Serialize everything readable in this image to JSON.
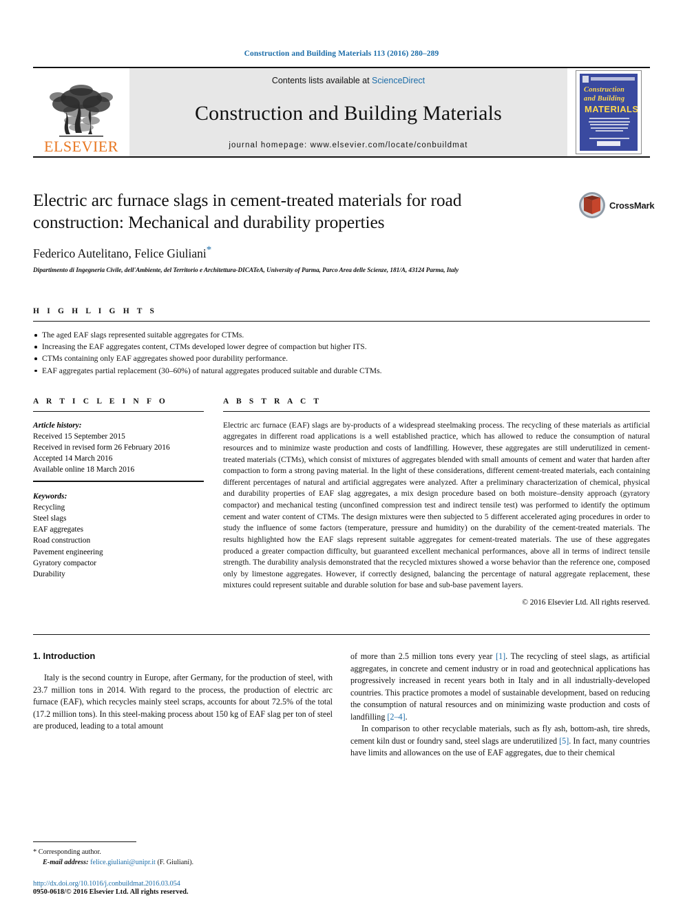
{
  "running_head": "Construction and Building Materials 113 (2016) 280–289",
  "masthead": {
    "publisher": "ELSEVIER",
    "contents_prefix": "Contents lists available at ",
    "contents_link": "ScienceDirect",
    "journal_name": "Construction and Building Materials",
    "homepage": "journal homepage: www.elsevier.com/locate/conbuildmat",
    "cover": {
      "line1": "Construction",
      "line2": "and Building",
      "line3": "MATERIALS"
    }
  },
  "article": {
    "title": "Electric arc furnace slags in cement-treated materials for road construction: Mechanical and durability properties",
    "authors": "Federico Autelitano, Felice Giuliani",
    "corresponding_marker": "*",
    "affiliation": "Dipartimento di Ingegneria Civile, dell'Ambiente, del Territorio e Architettura-DICATeA, University of Parma, Parco Area delle Scienze, 181/A, 43124 Parma, Italy",
    "crossmark_label": "CrossMark"
  },
  "highlights": {
    "heading": "H I G H L I G H T S",
    "items": [
      "The aged EAF slags represented suitable aggregates for CTMs.",
      "Increasing the EAF aggregates content, CTMs developed lower degree of compaction but higher ITS.",
      "CTMs containing only EAF aggregates showed poor durability performance.",
      "EAF aggregates partial replacement (30–60%) of natural aggregates produced suitable and durable CTMs."
    ]
  },
  "article_info": {
    "heading": "A R T I C L E    I N F O",
    "history_label": "Article history:",
    "history": [
      "Received 15 September 2015",
      "Received in revised form 26 February 2016",
      "Accepted 14 March 2016",
      "Available online 18 March 2016"
    ],
    "keywords_label": "Keywords:",
    "keywords": [
      "Recycling",
      "Steel slags",
      "EAF aggregates",
      "Road construction",
      "Pavement engineering",
      "Gyratory compactor",
      "Durability"
    ]
  },
  "abstract": {
    "heading": "A B S T R A C T",
    "text": "Electric arc furnace (EAF) slags are by-products of a widespread steelmaking process. The recycling of these materials as artificial aggregates in different road applications is a well established practice, which has allowed to reduce the consumption of natural resources and to minimize waste production and costs of landfilling. However, these aggregates are still underutilized in cement-treated materials (CTMs), which consist of mixtures of aggregates blended with small amounts of cement and water that harden after compaction to form a strong paving material. In the light of these considerations, different cement-treated materials, each containing different percentages of natural and artificial aggregates were analyzed. After a preliminary characterization of chemical, physical and durability properties of EAF slag aggregates, a mix design procedure based on both moisture–density approach (gyratory compactor) and mechanical testing (unconfined compression test and indirect tensile test) was performed to identify the optimum cement and water content of CTMs. The design mixtures were then subjected to 5 different accelerated aging procedures in order to study the influence of some factors (temperature, pressure and humidity) on the durability of the cement-treated materials. The results highlighted how the EAF slags represent suitable aggregates for cement-treated materials. The use of these aggregates produced a greater compaction difficulty, but guaranteed excellent mechanical performances, above all in terms of indirect tensile strength. The durability analysis demonstrated that the recycled mixtures showed a worse behavior than the reference one, composed only by limestone aggregates. However, if correctly designed, balancing the percentage of natural aggregate replacement, these mixtures could represent suitable and durable solution for base and sub-base pavement layers.",
    "copyright": "© 2016 Elsevier Ltd. All rights reserved."
  },
  "introduction": {
    "section_title": "1. Introduction",
    "left_paragraph": "Italy is the second country in Europe, after Germany, for the production of steel, with 23.7 million tons in 2014. With regard to the process, the production of electric arc furnace (EAF), which recycles mainly steel scraps, accounts for about 72.5% of the total (17.2 million tons). In this steel-making process about 150 kg of EAF slag per ton of steel are produced, leading to a total amount",
    "right_paragraph_1_a": "of more than 2.5 million tons every year ",
    "right_paragraph_1_ref1": "[1]",
    "right_paragraph_1_b": ". The recycling of steel slags, as artificial aggregates, in concrete and cement industry or in road and geotechnical applications has progressively increased in recent years both in Italy and in all industrially-developed countries. This practice promotes a model of sustainable development, based on reducing the consumption of natural resources and on minimizing waste production and costs of landfilling ",
    "right_paragraph_1_ref2": "[2–4]",
    "right_paragraph_1_c": ".",
    "right_paragraph_2_a": "In comparison to other recyclable materials, such as fly ash, bottom-ash, tire shreds, cement kiln dust or foundry sand, steel slags are underutilized ",
    "right_paragraph_2_ref": "[5]",
    "right_paragraph_2_b": ". In fact, many countries have limits and allowances on the use of EAF aggregates, due to their chemical"
  },
  "footnote": {
    "corresponding_star": "*",
    "corresponding_text": "Corresponding author.",
    "email_label": "E-mail address:",
    "email": "felice.giuliani@unipr.it",
    "email_suffix": "(F. Giuliani).",
    "doi": "http://dx.doi.org/10.1016/j.conbuildmat.2016.03.054",
    "issn": "0950-0618/© 2016 Elsevier Ltd. All rights reserved."
  },
  "colors": {
    "link_blue": "#1b6ca8",
    "elsevier_orange": "#E87722",
    "cover_blue": "#3a4aa0",
    "cover_yellow": "#ffd84d"
  }
}
